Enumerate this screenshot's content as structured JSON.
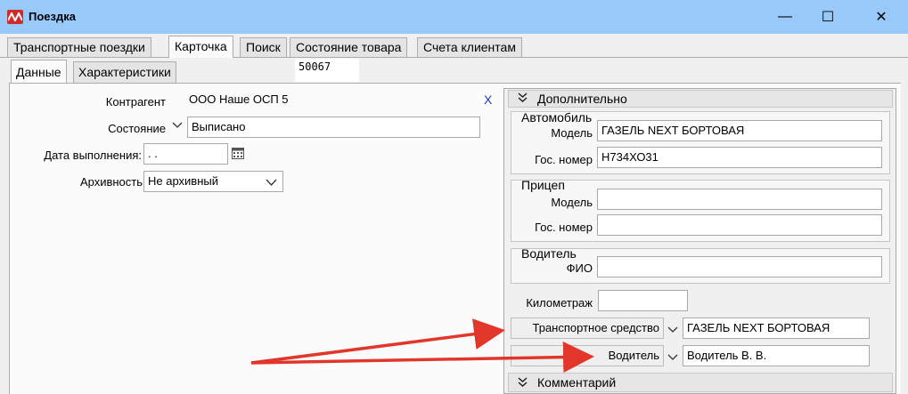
{
  "window": {
    "title": "Поездка",
    "minimize": "—",
    "maximize": "☐",
    "close": "✕"
  },
  "tabs": [
    {
      "label": "Транспортные поездки"
    },
    {
      "label": "Карточка"
    },
    {
      "label": "Поиск"
    },
    {
      "label": "Состояние товара"
    },
    {
      "label": "Счета клиентам"
    }
  ],
  "subtabs": [
    {
      "label": "Данные"
    },
    {
      "label": "Характеристики"
    }
  ],
  "record_id": "50067",
  "form": {
    "counterparty_label": "Контрагент",
    "counterparty_value": "ООО Наше ОСП 5",
    "clear_label": "X",
    "state_label": "Состояние",
    "state_value": "Выписано",
    "date_label": "Дата выполнения:",
    "date_value": ". .",
    "archive_label": "Архивность",
    "archive_value": "Не архивный"
  },
  "panel": {
    "header": "Дополнительно",
    "car": {
      "title": "Автомобиль",
      "model_label": "Модель",
      "model_value": "ГАЗЕЛЬ NEXT БОРТОВАЯ",
      "plate_label": "Гос. номер",
      "plate_value": "Н734ХО31"
    },
    "trailer": {
      "title": "Прицеп",
      "model_label": "Модель",
      "model_value": "",
      "plate_label": "Гос. номер",
      "plate_value": ""
    },
    "driver": {
      "title": "Водитель",
      "fio_label": "ФИО",
      "fio_value": ""
    },
    "mileage_label": "Километраж",
    "mileage_value": "",
    "vehicle_label": "Транспортное средство",
    "vehicle_value": "ГАЗЕЛЬ NEXT БОРТОВАЯ",
    "driver_label": "Водитель",
    "driver_value": "Водитель В. В.",
    "comment_header": "Комментарий"
  },
  "colors": {
    "titlebar": "#99c9f8",
    "arrow": "#e2362b",
    "link": "#1a3fa8"
  }
}
